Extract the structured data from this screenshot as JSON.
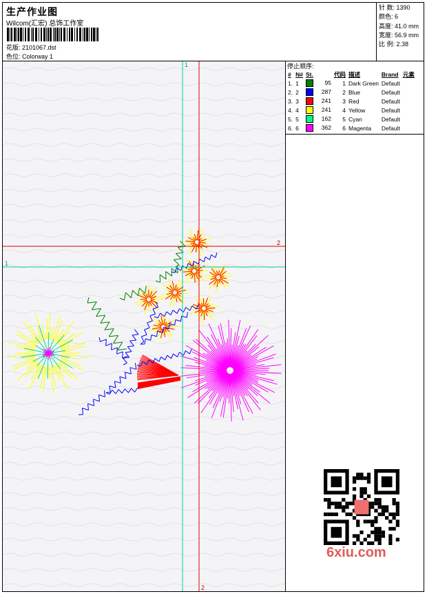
{
  "header": {
    "title": "生产作业图",
    "company": "Wilcom(汇宏) 总饰工作室",
    "design_label": "花版: 2101067.dst",
    "colorway_label": "色位: Colorway 1"
  },
  "stats": {
    "stitches": "针 数: 1390",
    "colors": "颜色: 6",
    "height": "高度: 41.0 mm",
    "width": "宽度: 56.9 mm",
    "scale": "比 例: 2.38"
  },
  "sequence": {
    "heading": "停止顺序:",
    "columns": [
      "#",
      "N#",
      "St.",
      "代码",
      "描述",
      "Brand",
      "元素"
    ],
    "rows": [
      {
        "n": "1.",
        "nn": "1",
        "color": "#008000",
        "st": "95",
        "code": "1",
        "desc": "Dark Green",
        "brand": "Default"
      },
      {
        "n": "2.",
        "nn": "2",
        "color": "#0000ff",
        "st": "287",
        "code": "2",
        "desc": "Blue",
        "brand": "Default"
      },
      {
        "n": "3.",
        "nn": "3",
        "color": "#ff0000",
        "st": "241",
        "code": "3",
        "desc": "Red",
        "brand": "Default"
      },
      {
        "n": "4.",
        "nn": "4",
        "color": "#ffff00",
        "st": "241",
        "code": "4",
        "desc": "Yellow",
        "brand": "Default"
      },
      {
        "n": "5.",
        "nn": "5",
        "color": "#00ff80",
        "st": "162",
        "code": "5",
        "desc": "Cyan",
        "brand": "Default"
      },
      {
        "n": "6.",
        "nn": "6",
        "color": "#ff00ff",
        "st": "362",
        "code": "6",
        "desc": "Magenta",
        "brand": "Default"
      }
    ]
  },
  "guides": {
    "v1_label": "1",
    "v2_label": "2",
    "h1_label": "1",
    "h2_label": "2"
  },
  "watermark": {
    "site": "6xiu.com"
  }
}
